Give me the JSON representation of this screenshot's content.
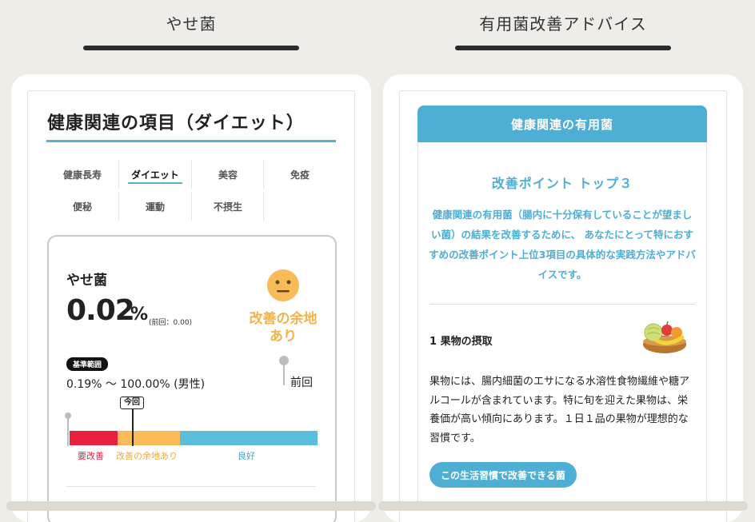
{
  "captions": {
    "left": "やせ菌",
    "right": "有用菌改善アドバイス"
  },
  "left_card": {
    "section_title": "健康関連の項目（ダイエット）",
    "tabs": [
      {
        "label": "健康長寿",
        "active": false
      },
      {
        "label": "ダイエット",
        "active": true
      },
      {
        "label": "美容",
        "active": false
      },
      {
        "label": "免疫",
        "active": false
      },
      {
        "label": "便秘",
        "active": false
      },
      {
        "label": "運動",
        "active": false
      },
      {
        "label": "不摂生",
        "active": false
      }
    ],
    "metric": {
      "name": "やせ菌",
      "value": "0.02",
      "unit": "%",
      "previous": "(前回：0.00)",
      "status": "改善の余地あり",
      "status_color": "#f2b44a",
      "face_icon": "neutral-face-icon",
      "range_badge": "基準範囲",
      "range_text": "0.19% ～ 100.00% (男性)",
      "previous_marker": "前回",
      "current_marker": "今回",
      "legend": {
        "red": "要改善",
        "orange": "改善の余地あり",
        "blue": "良好"
      },
      "colors": {
        "red": "#e8203f",
        "orange": "#f8bb57",
        "blue": "#5bbfdc"
      }
    }
  },
  "right_card": {
    "header": "健康関連の有用菌",
    "top3_title": "改善ポイント トップ３",
    "intro": "健康関連の有用菌（腸内に十分保有していることが望ましい菌）の結果を改善するために、 あなたにとって特におすすめの改善ポイント上位3項目の具体的な実践方法やアドバイスです。",
    "item": {
      "title": "1 果物の摂取",
      "icon": "fruit-basket-icon",
      "description": "果物には、腸内細菌のエサになる水溶性食物繊維や糖アルコールが含まれています。特に旬を迎えた果物は、栄養価が高い傾向にあります。１日１品の果物が理想的な習慣です。",
      "button": "この生活習慣で改善できる菌"
    },
    "accent": "#4eaed4"
  }
}
